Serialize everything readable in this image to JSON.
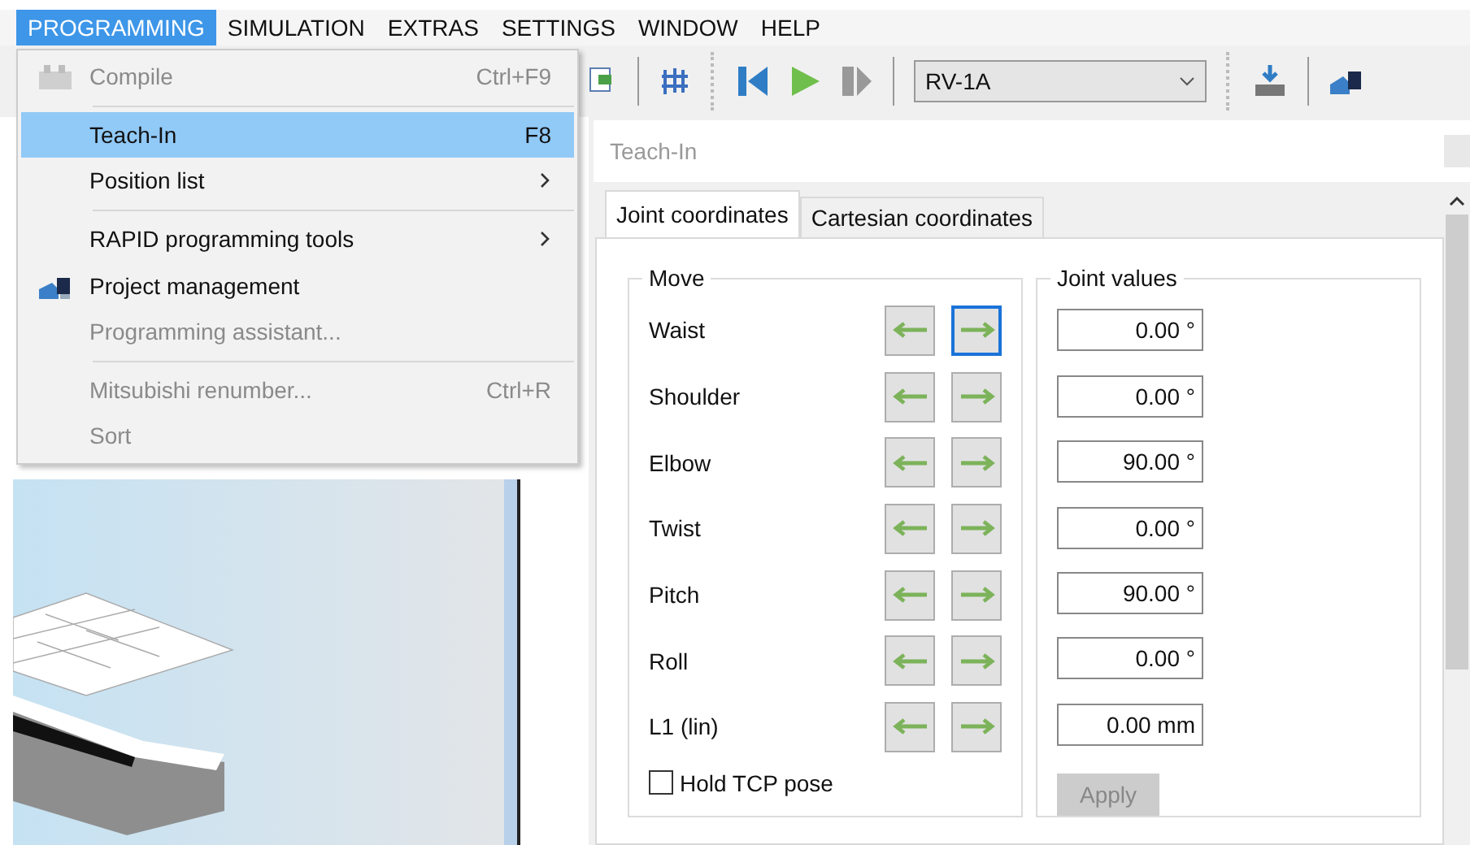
{
  "menubar": [
    {
      "label": "PROGRAMMING",
      "selected": true
    },
    {
      "label": "SIMULATION",
      "selected": false
    },
    {
      "label": "EXTRAS",
      "selected": false
    },
    {
      "label": "SETTINGS",
      "selected": false
    },
    {
      "label": "WINDOW",
      "selected": false
    },
    {
      "label": "HELP",
      "selected": false
    }
  ],
  "toolbar": {
    "robot_combo": "RV-1A"
  },
  "menu": [
    {
      "kind": "item",
      "label": "Compile",
      "shortcut": "Ctrl+F9",
      "disabled": true,
      "selected": false
    },
    {
      "kind": "separator"
    },
    {
      "kind": "item",
      "label": "Teach-In",
      "shortcut": "F8",
      "disabled": false,
      "selected": true
    },
    {
      "kind": "submenu",
      "label": "Position list",
      "disabled": false,
      "selected": false
    },
    {
      "kind": "separator"
    },
    {
      "kind": "submenu",
      "label": "RAPID programming tools",
      "disabled": false,
      "selected": false
    },
    {
      "kind": "item",
      "label": "Project management",
      "disabled": false,
      "selected": false
    },
    {
      "kind": "item",
      "label": "Programming assistant...",
      "disabled": true,
      "selected": false
    },
    {
      "kind": "separator"
    },
    {
      "kind": "item",
      "label": "Mitsubishi renumber...",
      "shortcut": "Ctrl+R",
      "disabled": true,
      "selected": false
    },
    {
      "kind": "item",
      "label": "Sort",
      "disabled": true,
      "selected": false
    }
  ],
  "panel": {
    "title": "Teach-In",
    "tabs": [
      {
        "label": "Joint coordinates",
        "selected": true
      },
      {
        "label": "Cartesian coordinates",
        "selected": false
      }
    ],
    "move_group": "Move",
    "values_group": "Joint values",
    "joints": [
      {
        "name": "Waist",
        "value": "0.00 °",
        "right_focused": true
      },
      {
        "name": "Shoulder",
        "value": "0.00 °",
        "right_focused": false
      },
      {
        "name": "Elbow",
        "value": "90.00 °",
        "right_focused": false
      },
      {
        "name": "Twist",
        "value": "0.00 °",
        "right_focused": false
      },
      {
        "name": "Pitch",
        "value": "90.00 °",
        "right_focused": false
      },
      {
        "name": "Roll",
        "value": "0.00 °",
        "right_focused": false
      },
      {
        "name": "L1 (lin)",
        "value": "0.00 mm",
        "right_focused": false
      }
    ],
    "hold_tcp": {
      "label": "Hold TCP pose",
      "checked": false
    },
    "apply": {
      "label": "Apply",
      "disabled": true
    }
  }
}
